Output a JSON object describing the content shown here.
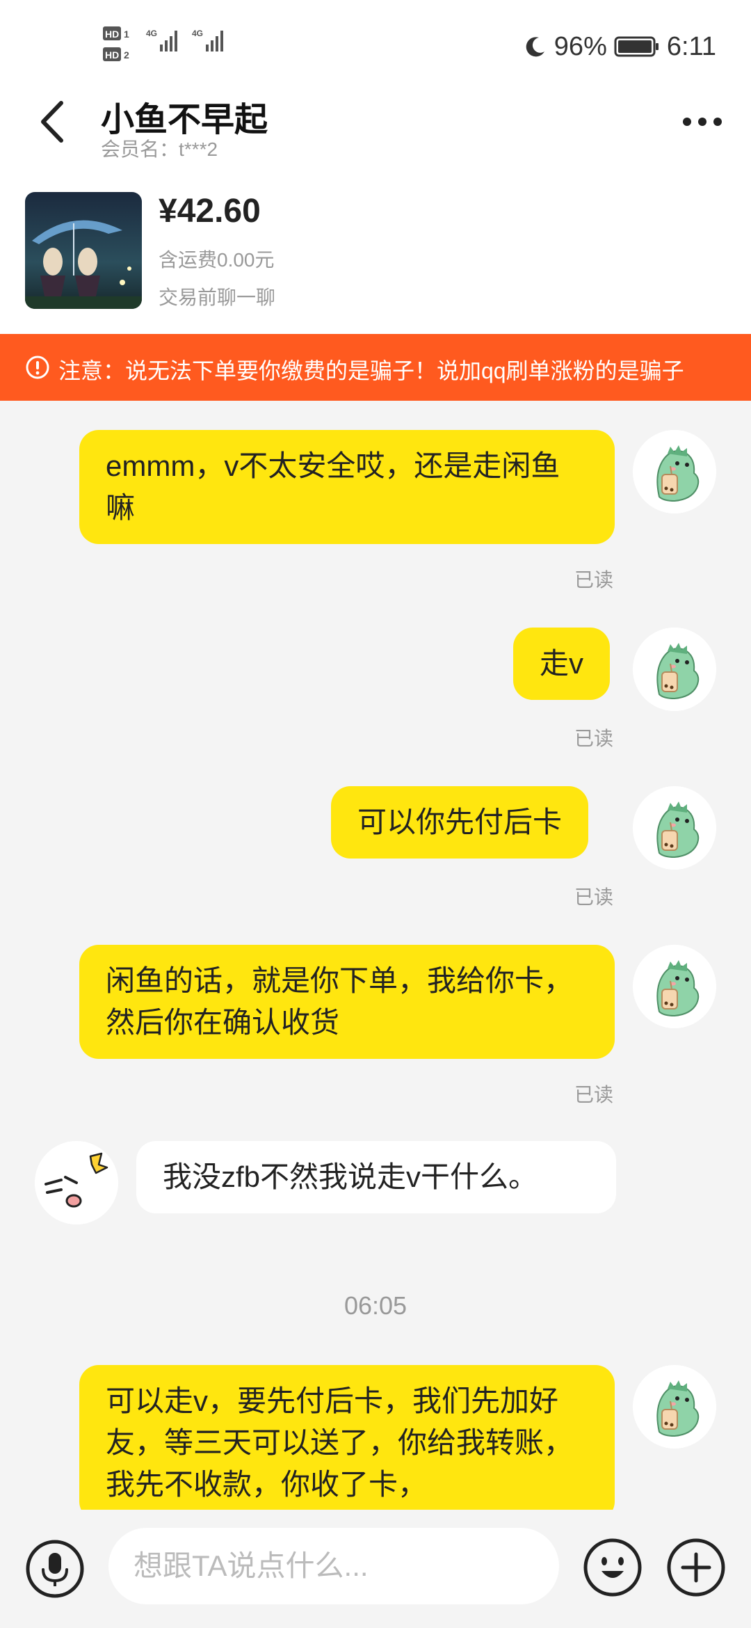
{
  "status_bar": {
    "sim1": "HD 1",
    "sim2": "HD 2",
    "network": "4G",
    "battery": "96%",
    "time": "6:11"
  },
  "header": {
    "title": "小鱼不早起",
    "subtitle": "会员名：t***2"
  },
  "product": {
    "price": "¥42.60",
    "shipping": "含运费0.00元",
    "cta": "交易前聊一聊"
  },
  "notice": {
    "text": "注意：说无法下单要你缴费的是骗子！说加qq刷单涨粉的是骗子"
  },
  "messages": [
    {
      "side": "mine",
      "text": "emmm，v不太安全哎，还是走闲鱼嘛",
      "status": "已读"
    },
    {
      "side": "mine",
      "text": "走v",
      "status": "已读"
    },
    {
      "side": "mine",
      "text": "可以你先付后卡",
      "status": "已读"
    },
    {
      "side": "mine",
      "text": "闲鱼的话，就是你下单，我给你卡，然后你在确认收货",
      "status": "已读"
    },
    {
      "side": "theirs",
      "text": "我没zfb不然我说走v干什么。"
    },
    {
      "side": "time",
      "text": "06:05"
    },
    {
      "side": "mine",
      "text": "可以走v，要先付后卡，我们先加好友，等三天可以送了，你给我转账，我先不收款，你收了卡，"
    }
  ],
  "input": {
    "placeholder": "想跟TA说点什么..."
  },
  "colors": {
    "accent": "#ffe60f",
    "notice_bg": "#ff5a1f",
    "background": "#f4f4f4"
  },
  "icons": {
    "back": "chevron-left-icon",
    "more": "more-dots-icon",
    "notice": "alert-circle-icon",
    "voice": "microphone-icon",
    "emoji": "smiley-icon",
    "add": "plus-icon"
  }
}
